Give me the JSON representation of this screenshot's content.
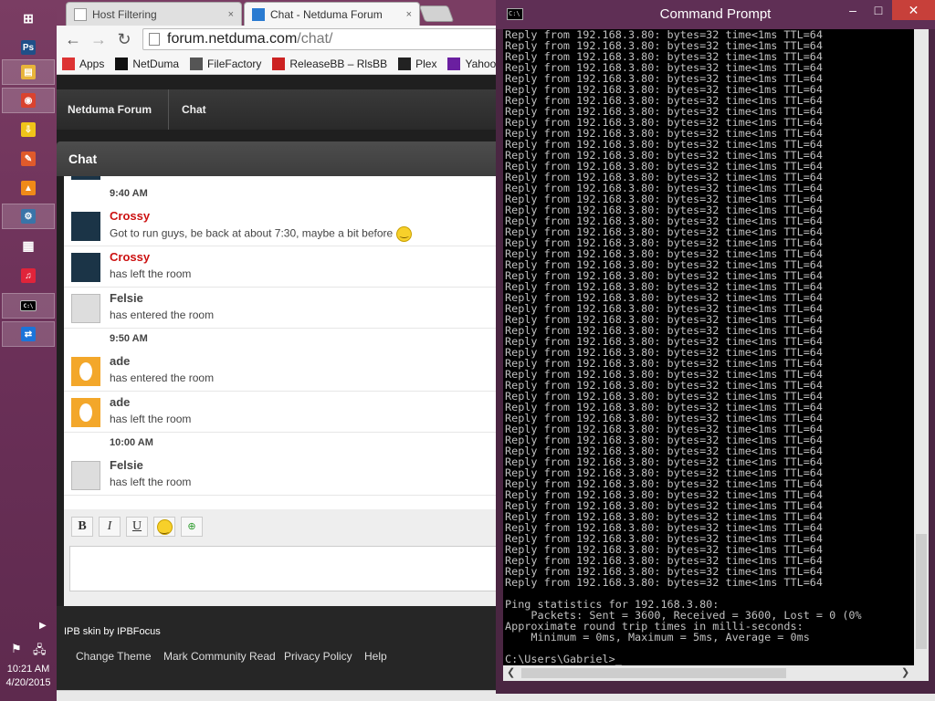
{
  "taskbar": {
    "time": "10:21 AM",
    "date": "4/20/2015",
    "apps": [
      {
        "name": "windows-icon",
        "label": "⊞",
        "color": "#ffffff",
        "active": false
      },
      {
        "name": "photoshop-icon",
        "label": "Ps",
        "color": "#1f4f88",
        "active": false
      },
      {
        "name": "file-explorer-icon",
        "label": "▤",
        "color": "#e8b43a",
        "active": true
      },
      {
        "name": "chrome-icon",
        "label": "◉",
        "color": "#d9432f",
        "active": true
      },
      {
        "name": "download-icon",
        "label": "⇩",
        "color": "#f0c419",
        "active": false
      },
      {
        "name": "paint-icon",
        "label": "✎",
        "color": "#e05a2b",
        "active": false
      },
      {
        "name": "vlc-icon",
        "label": "▲",
        "color": "#f08a18",
        "active": false
      },
      {
        "name": "python-icon",
        "label": "⚙",
        "color": "#3a74a8",
        "active": true
      },
      {
        "name": "calculator-icon",
        "label": "▦",
        "color": "#ffffff",
        "active": false
      },
      {
        "name": "itunes-icon",
        "label": "♫",
        "color": "#e0243a",
        "active": false
      },
      {
        "name": "cmd-icon",
        "label": "C:\\",
        "color": "#000000",
        "active": true
      },
      {
        "name": "teamviewer-icon",
        "label": "⇄",
        "color": "#1b74d9",
        "active": true
      }
    ]
  },
  "browser": {
    "tabs": [
      {
        "title": "Host Filtering",
        "close": "×"
      },
      {
        "title": "Chat - Netduma Forum",
        "close": "×"
      }
    ],
    "url_host": "forum.netduma.com",
    "url_path": "/chat/",
    "bookmarks": [
      {
        "label": "Apps",
        "icon": "apps-icon",
        "color": "#d33"
      },
      {
        "label": "NetDuma",
        "icon": "netduma-icon",
        "color": "#111"
      },
      {
        "label": "FileFactory",
        "icon": "filefactory-icon",
        "color": "#555"
      },
      {
        "label": "ReleaseBB – RlsBB",
        "icon": "releasebb-icon",
        "color": "#c22"
      },
      {
        "label": "Plex",
        "icon": "plex-icon",
        "color": "#222"
      },
      {
        "label": "Yahoo",
        "icon": "yahoo-icon",
        "color": "#6a1fa0"
      }
    ]
  },
  "forum": {
    "breadcrumb": [
      "Netduma Forum",
      "Chat"
    ],
    "header": "Chat",
    "messages": [
      {
        "type": "time",
        "text": "9:40 AM"
      },
      {
        "type": "msg",
        "user": "Crossy",
        "text": "Got to run guys, be back at about 7:30, maybe a bit before",
        "avatar": "crossy",
        "red": true,
        "smiley": true
      },
      {
        "type": "msg",
        "user": "Crossy",
        "text": "has left the room",
        "avatar": "crossy",
        "red": true
      },
      {
        "type": "msg",
        "user": "Felsie",
        "text": "has entered the room",
        "avatar": "felsie"
      },
      {
        "type": "time",
        "text": "9:50 AM"
      },
      {
        "type": "msg",
        "user": "ade",
        "text": "has entered the room",
        "avatar": "ade"
      },
      {
        "type": "msg",
        "user": "ade",
        "text": "has left the room",
        "avatar": "ade"
      },
      {
        "type": "time",
        "text": "10:00 AM"
      },
      {
        "type": "msg",
        "user": "Felsie",
        "text": "has left the room",
        "avatar": "felsie"
      }
    ],
    "editor_buttons": [
      "B",
      "I",
      "U"
    ],
    "skin_credit": "IPB skin by IPBFocus",
    "footer_links": [
      "Change Theme",
      "Mark Community Read",
      "Privacy Policy",
      "Help"
    ]
  },
  "cmd": {
    "title": "Command Prompt",
    "reply_line": "Reply from 192.168.3.80: bytes=32 time<1ms TTL=64",
    "reply_count": 51,
    "stats": [
      "",
      "Ping statistics for 192.168.3.80:",
      "    Packets: Sent = 3600, Received = 3600, Lost = 0 (0%",
      "Approximate round trip times in milli-seconds:",
      "    Minimum = 0ms, Maximum = 5ms, Average = 0ms",
      "",
      "C:\\Users\\Gabriel>_"
    ]
  }
}
